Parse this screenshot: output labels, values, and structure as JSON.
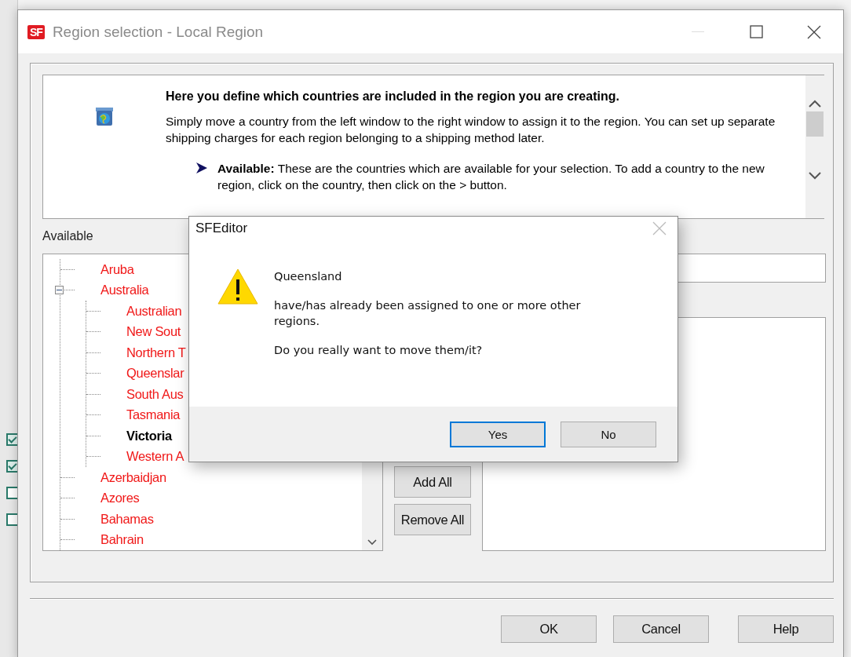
{
  "background_app": {
    "checkboxes": [
      {
        "checked": true
      },
      {
        "checked": true
      },
      {
        "checked": false
      },
      {
        "checked": false
      }
    ]
  },
  "window": {
    "logo": "SF",
    "title": "Region selection - Local Region"
  },
  "help": {
    "heading": "Here you define which countries are included in the region you are creating.",
    "text": "Simply move a country from the left window to the right window to assign it to the region. You can set up separate shipping charges for each region belonging to a shipping method later.",
    "bullets": [
      "**Available:** These are the countries which are available for your selection. To add a country to the new region, click on the country, then click on the > button."
    ]
  },
  "available": {
    "label": "Available",
    "tree": [
      {
        "label": "Aruba",
        "assigned": true
      },
      {
        "label": "Australia",
        "assigned": true,
        "expanded": true,
        "children": [
          {
            "label": "Australian",
            "assigned": true
          },
          {
            "label": "New Sout",
            "assigned": true
          },
          {
            "label": "Northern T",
            "assigned": true
          },
          {
            "label": "Queenslar",
            "assigned": true
          },
          {
            "label": "South Aus",
            "assigned": true
          },
          {
            "label": "Tasmania",
            "assigned": true
          },
          {
            "label": "Victoria",
            "assigned": false
          },
          {
            "label": "Western A",
            "assigned": true
          }
        ]
      },
      {
        "label": "Azerbaidjan",
        "assigned": true
      },
      {
        "label": "Azores",
        "assigned": true
      },
      {
        "label": "Bahamas",
        "assigned": true
      },
      {
        "label": "Bahrain",
        "assigned": true
      }
    ]
  },
  "move_buttons": [
    "Add All",
    "Remove All"
  ],
  "buttons": [
    "OK",
    "Cancel",
    "Help"
  ],
  "message_box": {
    "title": "SFEditor",
    "item": "Queensland",
    "message": "have/has already been assigned to one or more other regions.",
    "question": "Do you really want to move them/it?",
    "buttons": [
      {
        "label": "Yes",
        "focused": true
      },
      {
        "label": "No",
        "focused": false
      }
    ]
  }
}
